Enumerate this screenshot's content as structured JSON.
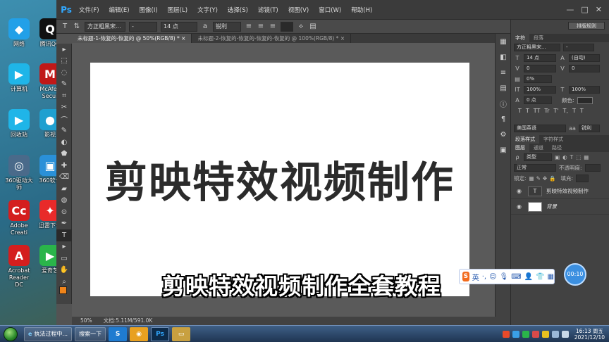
{
  "desktop": {
    "icons": [
      {
        "label": "网络",
        "glyph": "◆",
        "color": "#22a0e8"
      },
      {
        "label": "腾讯QQ",
        "glyph": "Q",
        "color": "#111111"
      },
      {
        "label": "计算机",
        "glyph": "▶",
        "color": "#1fb5e8"
      },
      {
        "label": "McAfee Secur",
        "glyph": "M",
        "color": "#c01818"
      },
      {
        "label": "回收站",
        "glyph": "▶",
        "color": "#1fb5e8"
      },
      {
        "label": "影视",
        "glyph": "●",
        "color": "#1fa0d0"
      },
      {
        "label": "360驱动大师",
        "glyph": "◎",
        "color": "#4a6a8a"
      },
      {
        "label": "360软件",
        "glyph": "▣",
        "color": "#2a90d8"
      },
      {
        "label": "Adobe Creati",
        "glyph": "Cc",
        "color": "#d41e1e"
      },
      {
        "label": "迅雷下载",
        "glyph": "✦",
        "color": "#e82a2a"
      },
      {
        "label": "Acrobat Reader DC",
        "glyph": "A",
        "color": "#d41e1e"
      },
      {
        "label": "爱奇艺",
        "glyph": "▶",
        "color": "#2ab54a"
      }
    ]
  },
  "photoshop": {
    "logo": "Ps",
    "menu": [
      "文件(F)",
      "编辑(E)",
      "图像(I)",
      "图层(L)",
      "文字(Y)",
      "选择(S)",
      "滤镜(T)",
      "视图(V)",
      "窗口(W)",
      "帮助(H)"
    ],
    "window_buttons": {
      "minimize": "—",
      "maximize": "□",
      "close": "✕"
    },
    "options": {
      "tool_icon": "T",
      "font_family": "方正粗黑宋...",
      "font_style": "-",
      "font_size": "14 点",
      "antialias": "锐利",
      "reset_label": "排版规则"
    },
    "tabs": [
      {
        "label": "未标题-1-恢复的-恢复的 @ 50%(RGB/8) *",
        "active": true,
        "close": "×"
      },
      {
        "label": "未标题-2-恢复的-恢复的-恢复的-恢复的 @ 100%(RGB/8) *",
        "active": false,
        "close": "×"
      }
    ],
    "canvas_text": "剪映特效视频制作",
    "status": {
      "zoom": "50%",
      "doc": "文档:5.11M/591.0K"
    },
    "tools": [
      "▸",
      "⬚",
      "◌",
      "✎",
      "⌗",
      "✂",
      "⌒",
      "✎",
      "◐",
      "⬟",
      "✚",
      "⌫",
      "▰",
      "◍",
      "⊙",
      "✒",
      "T",
      "▸",
      "▭",
      "✋",
      "⌕"
    ],
    "iconbar": [
      "▦",
      "◧",
      "≡",
      "▤",
      "ⓘ",
      "¶",
      "⚙",
      "▣"
    ],
    "character_panel": {
      "tabs": [
        "字符",
        "段落"
      ],
      "font_family": "方正粗黑宋...",
      "font_style": "-",
      "size": "14 点",
      "leading": "(自动)",
      "kerning": "0",
      "tracking": "0",
      "tsume": "0%",
      "vscale": "100%",
      "hscale": "100%",
      "baseline": "0 点",
      "color_label": "颜色:",
      "styles": [
        "T",
        "T",
        "TT",
        "Tr",
        "T'",
        "T,",
        "T",
        "T"
      ],
      "language": "美国英语",
      "aa_label": "aa",
      "antialias": "锐利"
    },
    "styles_tabs": [
      "段落样式",
      "字符样式"
    ],
    "layers_panel": {
      "tabs": [
        "图层",
        "通道",
        "路径"
      ],
      "filter": "类型",
      "blend": "正常",
      "opacity_label": "不透明度:",
      "lock_label": "锁定:",
      "fill_label": "填充:",
      "layers": [
        {
          "name": "剪映特效视频制作",
          "thumb": "T"
        },
        {
          "name": "背景",
          "thumb": ""
        }
      ]
    }
  },
  "subtitle": "剪映特效视频制作全套教程",
  "ime": {
    "logo": "S",
    "lang": "英",
    "icons": [
      "·,",
      "☺",
      "🎙",
      "⌨",
      "👤",
      "👕",
      "▦"
    ]
  },
  "time_badge": "00:10",
  "taskbar": {
    "items": [
      {
        "label": "执法过程中...",
        "icon": "e"
      },
      {
        "label": "搜索一下"
      }
    ],
    "apps": [
      {
        "glyph": "S",
        "color": "#1f7bd0"
      },
      {
        "glyph": "◉",
        "color": "#e8a020"
      },
      {
        "glyph": "Ps",
        "color": "#0d2b4a"
      },
      {
        "glyph": "▭",
        "color": "#c8a040"
      }
    ],
    "clock": {
      "time": "16:13 周五",
      "date": "2021/12/10"
    }
  }
}
